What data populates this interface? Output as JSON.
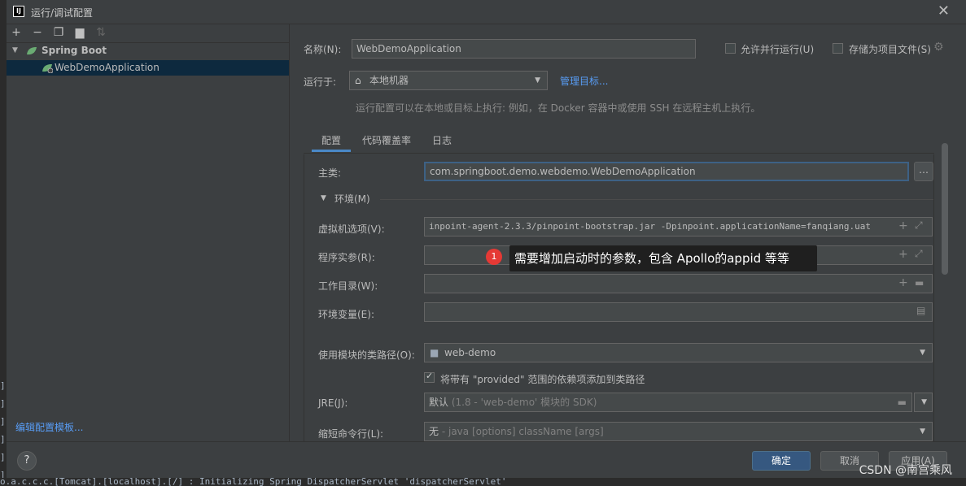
{
  "window": {
    "title": "运行/调试配置",
    "logo": "IJ"
  },
  "left": {
    "toolbar": [
      "plus-icon",
      "minus-icon",
      "copy-icon",
      "folder-add-icon",
      "sort-icon"
    ],
    "group_label": "Spring Boot",
    "item_label": "WebDemoApplication",
    "template_link": "编辑配置模板..."
  },
  "form": {
    "name_label": "名称(N):",
    "name_value": "WebDemoApplication",
    "parallel_label": "允许并行运行(U)",
    "store_label": "存储为项目文件(S)",
    "run_on_label": "运行于:",
    "run_on_value": "本地机器",
    "manage_link": "管理目标...",
    "run_on_hint": "运行配置可以在本地或目标上执行: 例如，在 Docker 容器中或使用 SSH 在远程主机上执行。"
  },
  "tabs": [
    "配置",
    "代码覆盖率",
    "日志"
  ],
  "config": {
    "main_class_label": "主类:",
    "main_class_value": "com.springboot.demo.webdemo.WebDemoApplication",
    "env_section": "环境(M)",
    "vm_label": "虚拟机选项(V):",
    "vm_value": "inpoint-agent-2.3.3/pinpoint-bootstrap.jar -Dpinpoint.applicationName=fanqiang.uat",
    "program_args_label": "程序实参(R):",
    "workdir_label": "工作目录(W):",
    "envvars_label": "环境变量(E):",
    "module_label": "使用模块的类路径(O):",
    "module_value": "web-demo",
    "provided_label": "将带有 \"provided\" 范围的依赖项添加到类路径",
    "jre_label": "JRE(J):",
    "jre_value_main": "默认",
    "jre_value_hint": "(1.8 - 'web-demo' 模块的 SDK)",
    "shorten_label": "缩短命令行(L):",
    "shorten_value_main": "无",
    "shorten_value_hint": "- java [options] className [args]"
  },
  "buttons": {
    "ok": "确定",
    "cancel": "取消",
    "apply": "应用(A)",
    "help": "?"
  },
  "annotation": {
    "badge": "1",
    "text": "需要增加启动时的参数，包含 Apollo的appid 等等"
  },
  "console_line": "o.a.c.c.c.[Tomcat].[localhost].[/]       : Initializing Spring DispatcherServlet 'dispatcherServlet'",
  "watermark": "CSDN @南宫乘风"
}
